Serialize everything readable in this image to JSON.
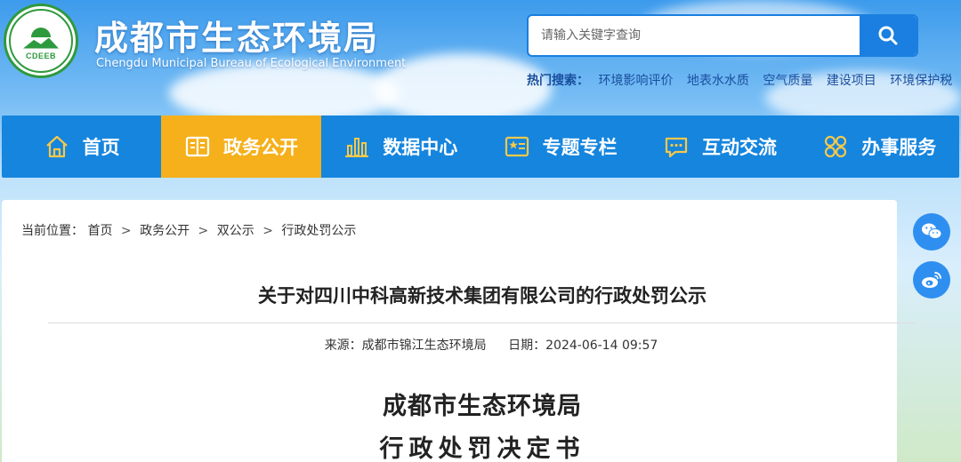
{
  "header": {
    "title": "成都市生态环境局",
    "subtitle": "Chengdu Municipal Bureau of Ecological Environment",
    "logo_text": "CDEEB"
  },
  "search": {
    "placeholder": "请输入关键字查询",
    "button_icon": "search-icon"
  },
  "hot_search": {
    "label": "热门搜索：",
    "links": [
      "环境影响评价",
      "地表水水质",
      "空气质量",
      "建设项目",
      "环境保护税"
    ]
  },
  "nav": {
    "items": [
      {
        "label": "首页",
        "icon": "home-icon"
      },
      {
        "label": "政务公开",
        "icon": "book-icon",
        "active": true
      },
      {
        "label": "数据中心",
        "icon": "bar-chart-icon"
      },
      {
        "label": "专题专栏",
        "icon": "news-icon"
      },
      {
        "label": "互动交流",
        "icon": "chat-icon"
      },
      {
        "label": "办事服务",
        "icon": "grid-icon"
      }
    ],
    "active_color": "#f5b01b",
    "bg_color": "#1585de"
  },
  "breadcrumb": {
    "label": "当前位置：",
    "items": [
      "首页",
      "政务公开",
      "双公示",
      "行政处罚公示"
    ]
  },
  "article": {
    "title": "关于对四川中科高新技术集团有限公司的行政处罚公示",
    "source": "来源：成都市锦江生态环境局",
    "date": "日期：2024-06-14 09:57",
    "doc_heading": "成都市生态环境局",
    "doc_subheading": "行政处罚决定书"
  },
  "share": {
    "items": [
      "wechat-icon",
      "weibo-icon"
    ]
  }
}
